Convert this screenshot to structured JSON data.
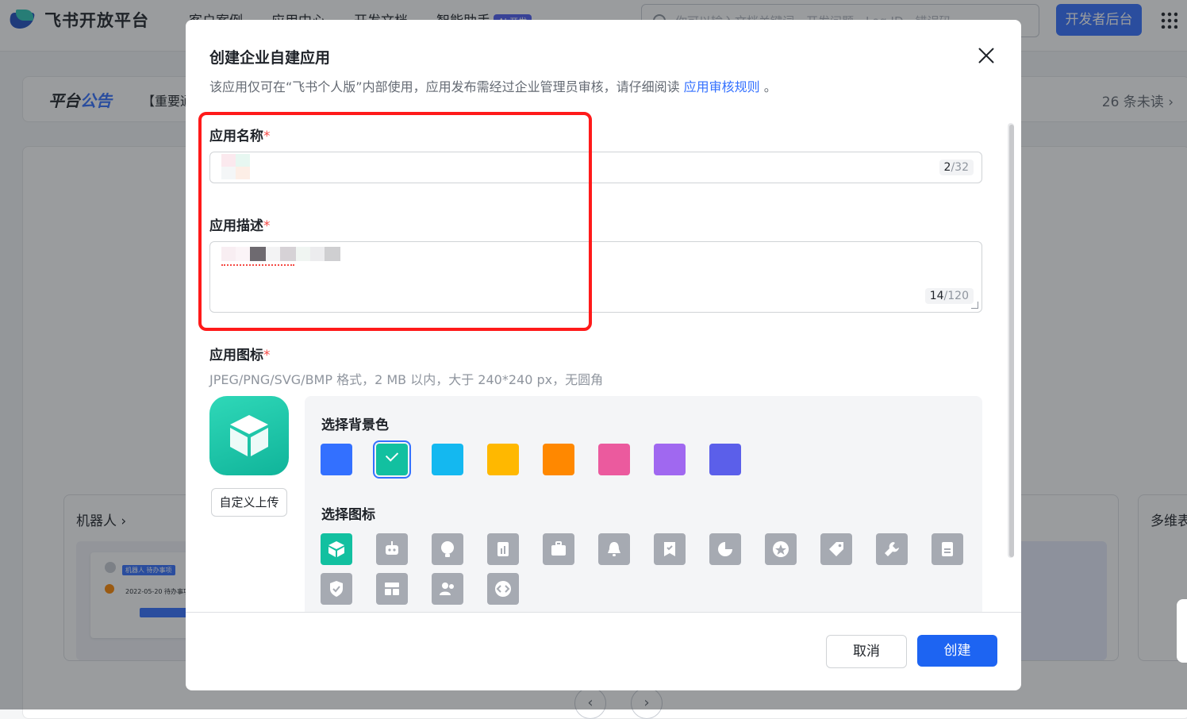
{
  "header": {
    "logo_text": "飞书开放平台",
    "nav": [
      "客户案例",
      "应用中心",
      "开发文档",
      "智能助手"
    ],
    "ai_badge": "AI 开发",
    "search_placeholder": "你可以输入文档关键词、开发问题、Log ID、错误码",
    "dev_console_label": "开发者后台"
  },
  "announcement": {
    "title_a": "平台",
    "title_b": "公告",
    "text": "【重要通",
    "unread": "26 条未读 ›"
  },
  "background_cards": {
    "robot_title": "机器人 ›",
    "robot_preview_tag": "机器人 待办事项",
    "robot_preview_line": "2022-05-20 待办事项",
    "far_title": "多维表"
  },
  "modal": {
    "title": "创建企业自建应用",
    "description": "该应用仅可在“飞书个人版”内部使用，应用发布需经过企业管理员审核，请仔细阅读 ",
    "description_link": "应用审核规则",
    "description_end": " 。",
    "name_label": "应用名称",
    "name_counter_current": "2",
    "name_counter_max": "/32",
    "desc_label": "应用描述",
    "desc_counter_current": "14",
    "desc_counter_max": "/120",
    "required_mark": "*",
    "icon_label": "应用图标",
    "icon_hint": "JPEG/PNG/SVG/BMP 格式，2 MB 以内，大于 240*240 px，无圆角",
    "upload_label": "自定义上传",
    "bg_color_title": "选择背景色",
    "icon_title": "选择图标",
    "bg_colors": [
      "#3370ff",
      "#12c0a0",
      "#14b8f0",
      "#ffb800",
      "#ff8800",
      "#eb5a9e",
      "#a068f0",
      "#5b5fea"
    ],
    "selected_bg_color": "#12c0a0",
    "icons": [
      "cube-icon",
      "robot-icon",
      "lightbulb-icon",
      "document-chart-icon",
      "briefcase-icon",
      "bell-icon",
      "bookmark-check-icon",
      "pie-chart-icon",
      "star-badge-icon",
      "tag-icon",
      "wrench-icon",
      "file-icon",
      "shield-check-icon",
      "layout-icon",
      "people-icon",
      "code-icon"
    ],
    "cancel_label": "取消",
    "create_label": "创建"
  },
  "pager": {
    "prev": "‹",
    "next": "›"
  }
}
